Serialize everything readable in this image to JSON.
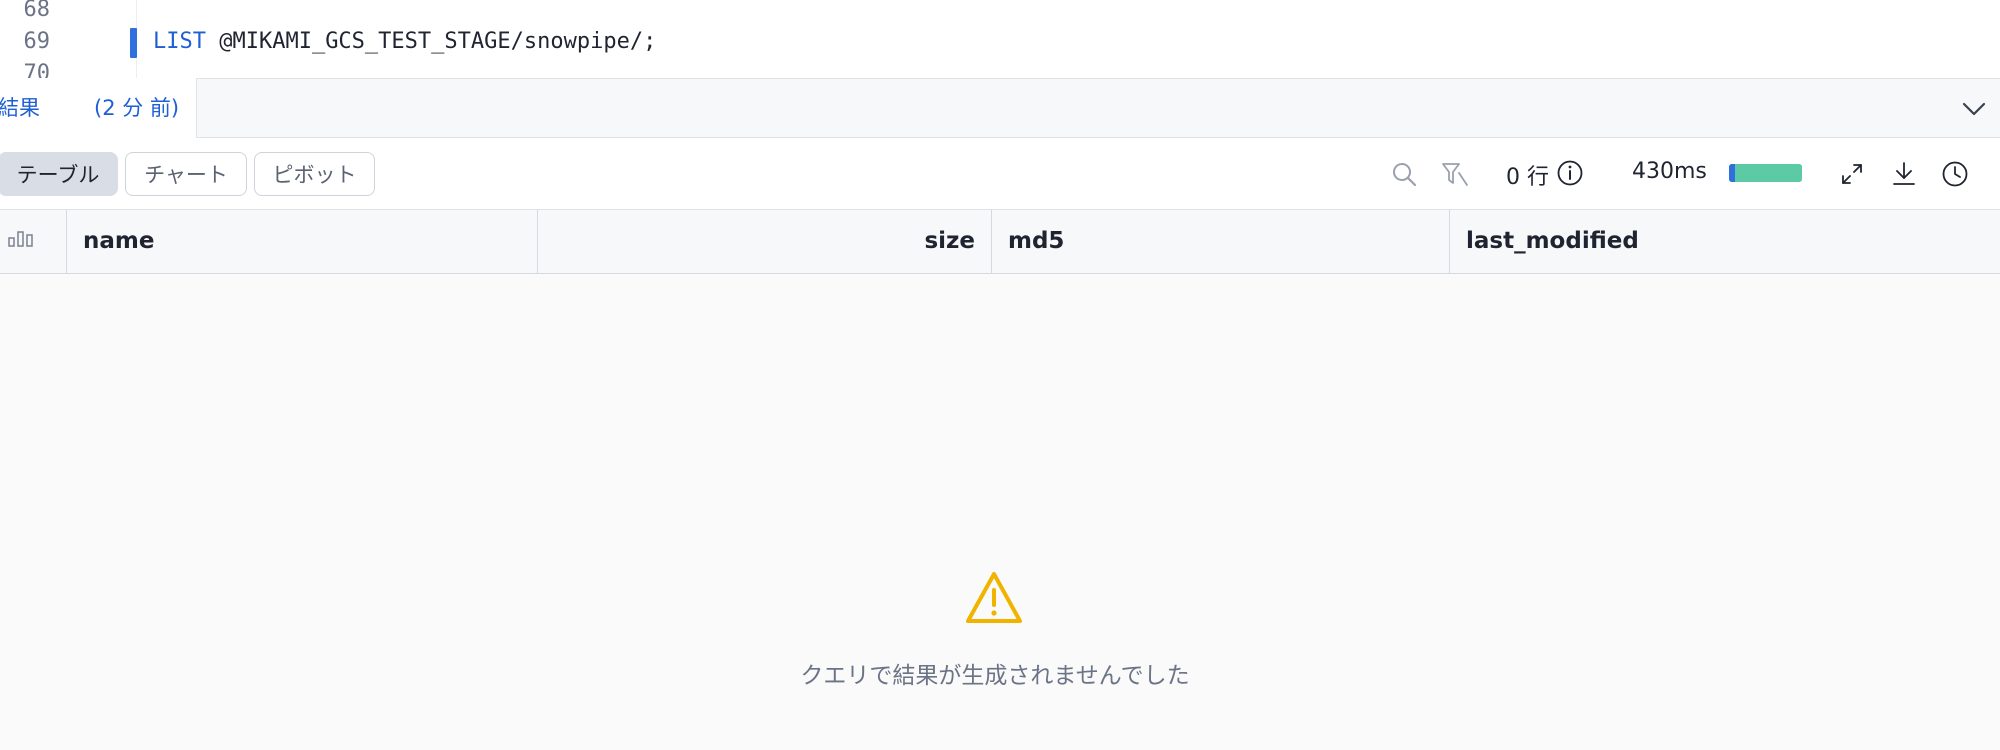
{
  "editor": {
    "lines": [
      {
        "number": "68",
        "code": ""
      },
      {
        "number": "69",
        "keyword": "LIST",
        "code": " @MIKAMI_GCS_TEST_STAGE/snowpipe/;"
      },
      {
        "number": "70",
        "code": ""
      }
    ]
  },
  "results_tab": {
    "title": "結果",
    "time_ago": "(2 分 前)"
  },
  "toolbar": {
    "views": [
      "テーブル",
      "チャート",
      "ピボット"
    ],
    "selected_view": "テーブル",
    "row_count": "0 行",
    "duration": "430ms",
    "progress_percent": 100,
    "icons": [
      "search-icon",
      "filter-icon",
      "info-icon",
      "expand-icon",
      "download-icon",
      "history-icon"
    ]
  },
  "table": {
    "columns": [
      {
        "name": "name"
      },
      {
        "name": "size"
      },
      {
        "name": "md5"
      },
      {
        "name": "last_modified"
      }
    ]
  },
  "empty_state": {
    "icon": "warning-icon",
    "message": "クエリで結果が生成されませんでした"
  },
  "colors": {
    "accent": "#1f5fd4",
    "progress": "#57c9a6",
    "warning": "#f0b400"
  }
}
